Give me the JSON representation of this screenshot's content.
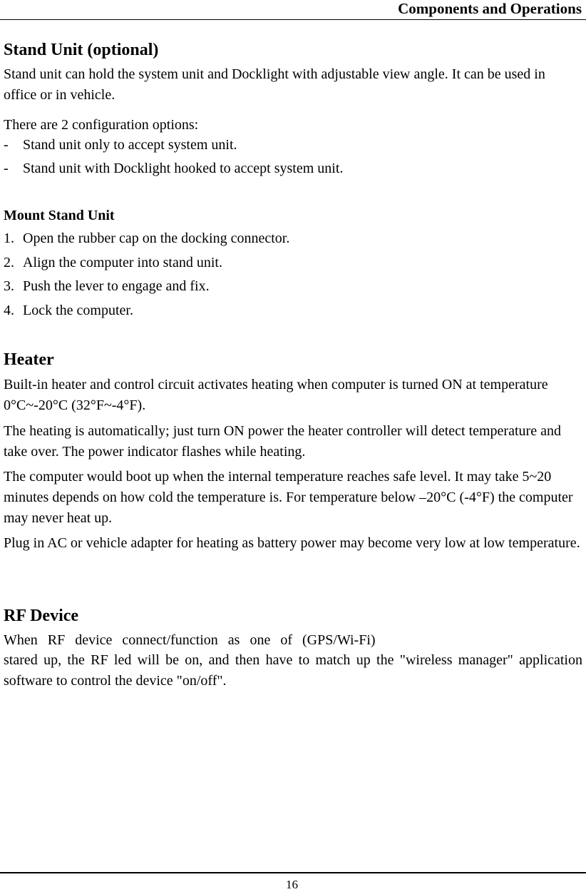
{
  "header": {
    "title": "Components and Operations"
  },
  "sections": {
    "stand_unit": {
      "heading": "Stand Unit (optional)",
      "intro": "Stand unit can hold the system unit and Docklight with adjustable view angle. It can be used in office or in vehicle.",
      "options_intro": "There are 2 configuration options:",
      "options": [
        {
          "marker": "-",
          "text": "Stand unit only to accept system unit."
        },
        {
          "marker": "-",
          "text": "Stand unit with Docklight hooked to accept system unit."
        }
      ],
      "mount": {
        "heading": "Mount Stand Unit",
        "steps": [
          {
            "marker": "1.",
            "text": "Open the rubber cap on the docking connector."
          },
          {
            "marker": "2.",
            "text": "Align the computer into stand unit."
          },
          {
            "marker": "3.",
            "text": "Push the lever to engage and fix."
          },
          {
            "marker": "4.",
            "text": "Lock the computer."
          }
        ]
      }
    },
    "heater": {
      "heading": "Heater",
      "paragraphs": [
        "Built-in heater and control circuit activates heating when computer is turned ON at temperature 0°C~-20°C (32°F~-4°F).",
        "The heating is automatically; just turn ON power the heater controller will detect temperature and take over. The power indicator flashes while heating.",
        "The computer would boot up when the internal temperature reaches safe level. It may take 5~20 minutes depends on how cold the temperature is. For temperature below –20°C (-4°F) the computer may never heat up.",
        "Plug in AC or vehicle adapter for heating as battery power may become very low at low temperature."
      ]
    },
    "rf_device": {
      "heading": "RF Device",
      "line1": "When RF device connect/function as one of (GPS/Wi-Fi)",
      "line2": "stared up, the RF led will be on, and then have to match up the \"wireless manager\" application software to control the device \"on/off\"."
    }
  },
  "footer": {
    "page_number": "16"
  }
}
